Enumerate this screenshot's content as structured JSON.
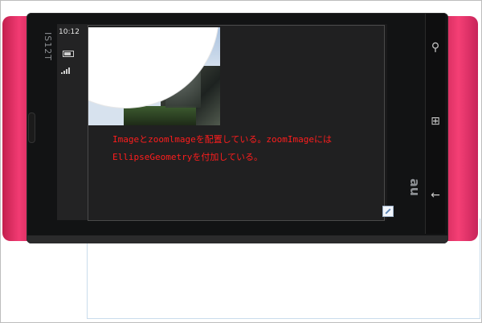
{
  "device": {
    "brand_label": "IS12T",
    "au_label": "au",
    "status": {
      "time": "10:12"
    },
    "hardware_keys": [
      {
        "name": "search",
        "glyph": "⚲"
      },
      {
        "name": "windows",
        "glyph": "⊞"
      },
      {
        "name": "back",
        "glyph": "←"
      }
    ]
  },
  "app": {
    "description_line1": "Imageとzoomlmageを配置している。zoomImageには",
    "description_line2": "EllipseGeometryを付加している。"
  },
  "colors": {
    "phone_pink": "#f23b73",
    "screen_bg": "#1a1a1b",
    "note_text": "#ff1d1d"
  }
}
